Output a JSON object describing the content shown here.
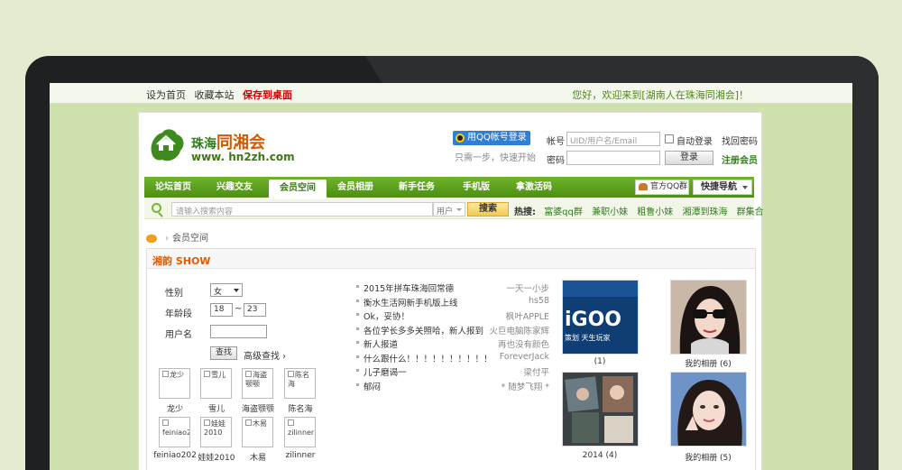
{
  "topbar": {
    "links": [
      "设为首页",
      "收藏本站"
    ],
    "save_desktop": "保存到桌面",
    "welcome": "您好，欢迎来到[湖南人在珠海同湘会]！"
  },
  "logo": {
    "name_a": "珠海",
    "name_b": "同湘会",
    "url": "www. hn2zh.com"
  },
  "login": {
    "qq_button": "用QQ帐号登录",
    "qq_hint": "只需一步，快速开始",
    "account_label": "帐号",
    "account_placeholder": "UID/用户名/Email",
    "password_label": "密码",
    "auto_login": "自动登录",
    "login_button": "登录",
    "find_password": "找回密码",
    "register": "注册会员"
  },
  "nav": {
    "items": [
      "论坛首页",
      "兴趣交友",
      "会员空间",
      "会员相册",
      "新手任务",
      "手机版",
      "拿激活码"
    ],
    "active": "会员空间",
    "qq_group": "官方QQ群",
    "quick_nav": "快捷导航"
  },
  "search": {
    "placeholder": "请输入搜索内容",
    "type": "用户",
    "button": "搜索",
    "hot_label": "热搜:",
    "hot_items": [
      "富婆qq群",
      "兼职小妹",
      "粗鲁小妹",
      "湘潭到珠海",
      "群集合"
    ]
  },
  "breadcrumb": {
    "current": "会员空间"
  },
  "panel": {
    "title": "湘韵 SHOW",
    "gender_label": "性别",
    "gender_value": "女",
    "age_label": "年龄段",
    "age_from": "18",
    "age_sep": "~",
    "age_to": "23",
    "username_label": "用户名",
    "search_button": "查找",
    "advanced": "高级查找 ›",
    "members": [
      {
        "alt": "龙少",
        "name": "龙少"
      },
      {
        "alt": "雪儿",
        "name": "雪儿"
      },
      {
        "alt": "海盗颚颚",
        "name": "海盗颚颚"
      },
      {
        "alt": "陈名海",
        "name": "陈名海"
      },
      {
        "alt": "feiniao20",
        "name": "feiniao202"
      },
      {
        "alt": "娃娃2010",
        "name": "娃娃2010"
      },
      {
        "alt": "木易",
        "name": "木易"
      },
      {
        "alt": "zilinner",
        "name": "zilinner"
      }
    ],
    "posts": [
      {
        "title": "2015年拼车珠海回常德",
        "author": "一天一小步"
      },
      {
        "title": "衡水生活网新手机版上线",
        "author": "hs58"
      },
      {
        "title": "Ok，妥协！",
        "author": "枫叶APPLE"
      },
      {
        "title": "各位学长多多关照哈，新人报到",
        "author": "火巨电脑陈家辉"
      },
      {
        "title": "新人报道",
        "author": "再也没有颜色"
      },
      {
        "title": "什么跟什么！！！！！！！！！！",
        "author": "ForeverJack"
      },
      {
        "title": "儿子磨谒一",
        "author": "梁付平"
      },
      {
        "title": "郁闷",
        "author": "* 随梦飞翔 *"
      }
    ],
    "photos": [
      {
        "caption": "(1)",
        "text_a": "iGOO",
        "text_b": "策划 天生玩家"
      },
      {
        "caption": "我的相册 (6)"
      },
      {
        "caption": "2014 (4)"
      },
      {
        "caption": "我的相册 (5)"
      }
    ]
  }
}
